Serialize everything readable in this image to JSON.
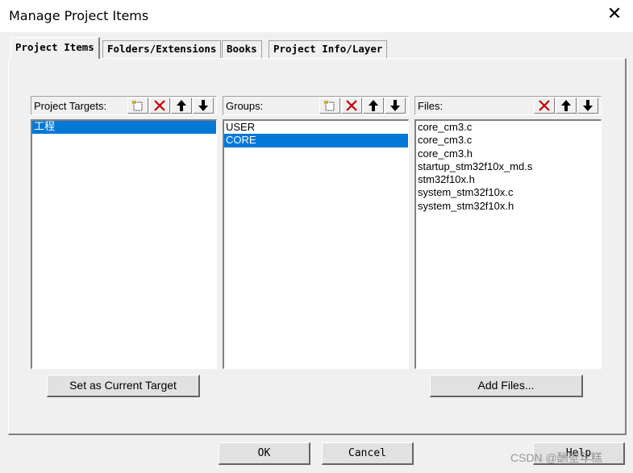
{
  "window": {
    "title": "Manage Project Items",
    "close_glyph": "✕"
  },
  "tabs": [
    {
      "label": "Project Items",
      "active": true
    },
    {
      "label": "Folders/Extensions",
      "active": false
    },
    {
      "label": "Books",
      "active": false
    },
    {
      "label": "Project Info/Layer",
      "active": false
    }
  ],
  "targets": {
    "header": "Project Targets:",
    "items": [
      "工程"
    ],
    "selected_index": 0
  },
  "groups": {
    "header": "Groups:",
    "items": [
      "USER",
      "CORE"
    ],
    "selected_index": 1
  },
  "files": {
    "header": "Files:",
    "items": [
      "core_cm3.c",
      "core_cm3.c",
      "core_cm3.h",
      "startup_stm32f10x_md.s",
      "stm32f10x.h",
      "system_stm32f10x.c",
      "system_stm32f10x.h"
    ]
  },
  "buttons": {
    "set_current_target": "Set as Current Target",
    "add_files": "Add Files...",
    "ok": "OK",
    "cancel": "Cancel",
    "help": "Help"
  },
  "icons": {
    "new": "new-item-icon",
    "delete": "delete-icon",
    "up": "move-up-icon",
    "down": "move-down-icon",
    "delete_color": "#c00000"
  },
  "watermark": "CSDN @酬壁年糕"
}
